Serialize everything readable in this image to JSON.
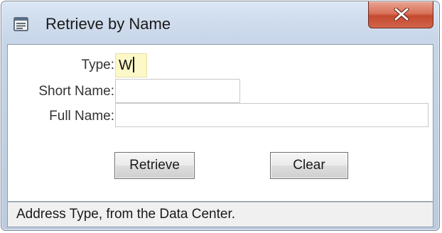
{
  "window": {
    "title": "Retrieve by Name",
    "icon": "document-window-icon",
    "close_icon": "close-x-icon"
  },
  "form": {
    "type_label": "Type:",
    "type_value": "W",
    "short_name_label": "Short Name:",
    "short_name_value": "",
    "full_name_label": "Full Name:",
    "full_name_value": ""
  },
  "buttons": {
    "retrieve_label": "Retrieve",
    "clear_label": "Clear"
  },
  "status": {
    "text": "Address Type, from the Data Center."
  },
  "colors": {
    "active_field_bg": "#fcf8c7",
    "close_button": "#c44a2f",
    "frame": "#c6d5e8"
  }
}
